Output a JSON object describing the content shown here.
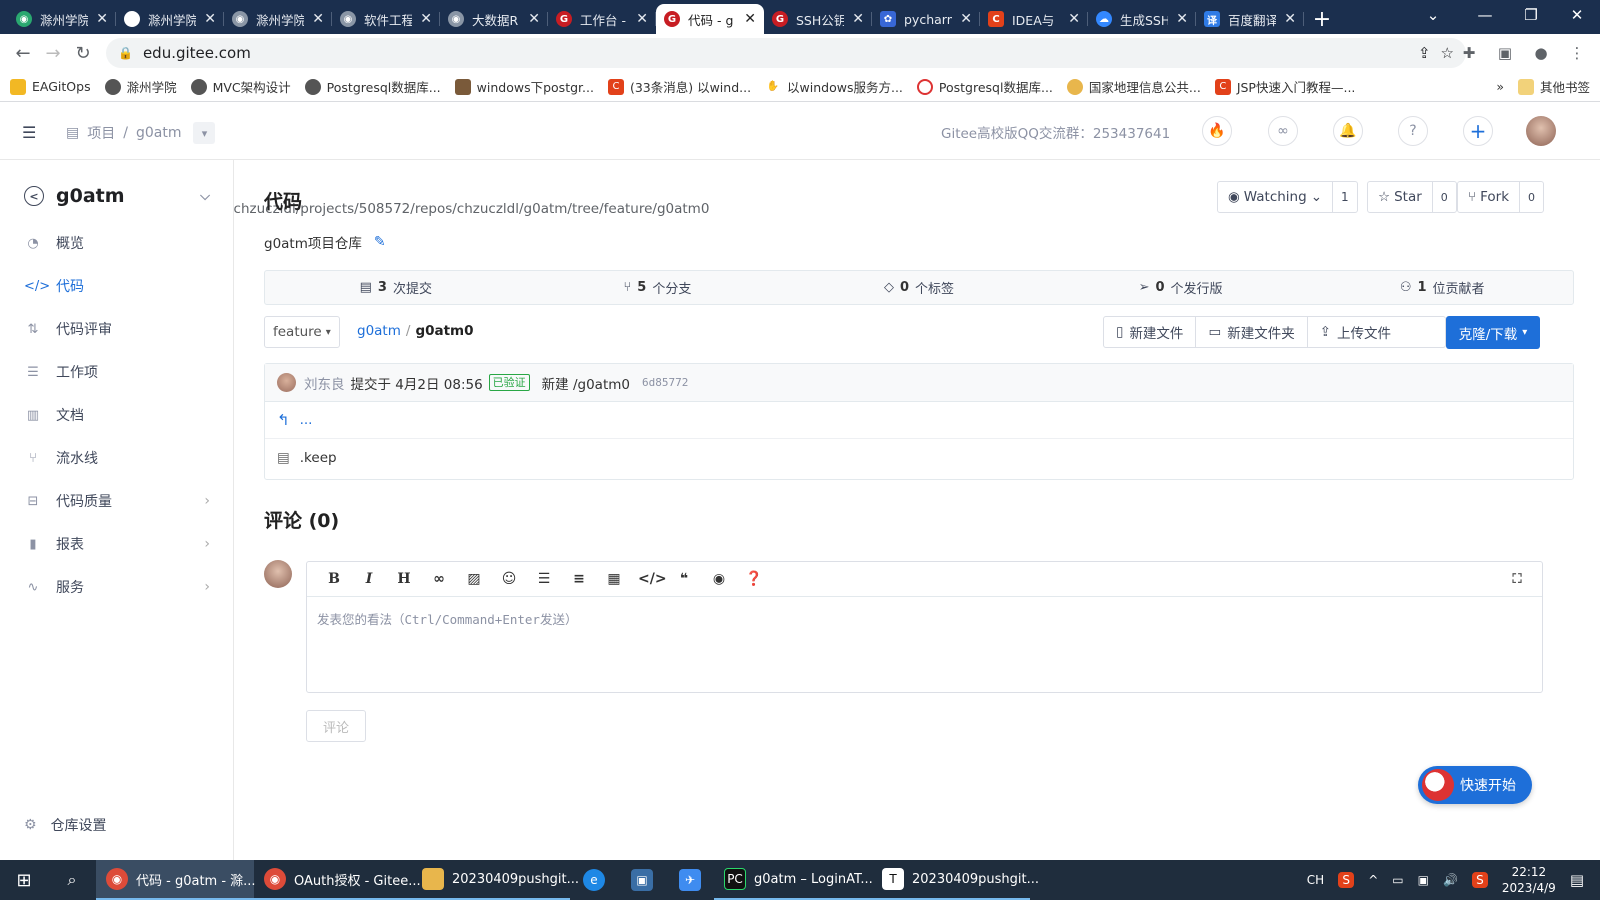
{
  "browser": {
    "tabs": [
      {
        "label": "滁州学院",
        "icon_color": "#2aa870"
      },
      {
        "label": "滁州学院",
        "icon_color": "#ffffff"
      },
      {
        "label": "滁州学院",
        "icon_color": "#8a96a6"
      },
      {
        "label": "软件工程",
        "icon_color": "#8a96a6"
      },
      {
        "label": "大数据R",
        "icon_color": "#8a96a6"
      },
      {
        "label": "工作台 -",
        "icon_color": "#c71d23"
      },
      {
        "label": "代码 - g",
        "icon_color": "#c71d23",
        "active": true
      },
      {
        "label": "SSH公钥",
        "icon_color": "#c71d23"
      },
      {
        "label": "pycharm",
        "icon_color": "#3867d6"
      },
      {
        "label": "IDEA与",
        "icon_color": "#e2411a"
      },
      {
        "label": "生成SSH",
        "icon_color": "#3388ff"
      },
      {
        "label": "百度翻译",
        "icon_color": "#2f7be6"
      }
    ],
    "url_host": "edu.gitee.com",
    "url_path": "/chzuczldl/projects/508572/repos/chzuczldl/g0atm/tree/feature/g0atm0",
    "bookmarks": [
      "EAGitOps",
      "滁州学院",
      "MVC架构设计",
      "Postgresql数据库...",
      "windows下postgr...",
      "(33条消息) 以wind...",
      "以windows服务方...",
      "Postgresql数据库...",
      "国家地理信息公共...",
      "JSP快速入门教程—..."
    ],
    "bookmarks_more": "»",
    "other_bookmarks": "其他书签"
  },
  "header": {
    "crumb_project": "项目",
    "crumb_sep": "/",
    "crumb_repo": "g0atm",
    "qq_group": "Gitee高校版QQ交流群：253437641"
  },
  "sidebar": {
    "project_name": "g0atm",
    "items": [
      {
        "label": "概览"
      },
      {
        "label": "代码"
      },
      {
        "label": "代码评审"
      },
      {
        "label": "工作项"
      },
      {
        "label": "文档"
      },
      {
        "label": "流水线"
      },
      {
        "label": "代码质量"
      },
      {
        "label": "报表"
      },
      {
        "label": "服务"
      }
    ],
    "settings": "仓库设置"
  },
  "main": {
    "title": "代码",
    "description": "g0atm项目仓库",
    "watching_label": "Watching",
    "watching_count": "1",
    "star_label": "Star",
    "star_count": "0",
    "fork_label": "Fork",
    "fork_count": "0",
    "stats": {
      "commits_n": "3",
      "commits_l": "次提交",
      "branches_n": "5",
      "branches_l": "个分支",
      "tags_n": "0",
      "tags_l": "个标签",
      "releases_n": "0",
      "releases_l": "个发行版",
      "contrib_n": "1",
      "contrib_l": "位贡献者"
    },
    "branch": "feature",
    "path_root": "g0atm",
    "path_sep": "/",
    "path_current": "g0atm0",
    "actions": {
      "new_file": "新建文件",
      "new_folder": "新建文件夹",
      "upload": "上传文件"
    },
    "clone": "克隆/下载",
    "commit": {
      "author": "刘东良",
      "time": "提交于 4月2日 08:56",
      "verified": "已验证",
      "message": "新建 /g0atm0",
      "hash": "6d85772"
    },
    "parent_dir": "...",
    "files": [
      ".keep"
    ],
    "comments_title": "评论 (0)",
    "editor_placeholder": "发表您的看法（Ctrl/Command+Enter发送）",
    "submit": "评论",
    "quick_start": "快速开始"
  },
  "taskbar": {
    "apps": [
      {
        "label": "代码 - g0atm - 滁...",
        "active": true
      },
      {
        "label": "OAuth授权 - Gitee..."
      },
      {
        "label": "20230409pushgit..."
      },
      {
        "label": ""
      },
      {
        "label": ""
      },
      {
        "label": ""
      },
      {
        "label": "g0atm – LoginAT..."
      },
      {
        "label": "20230409pushgit..."
      }
    ],
    "ime": "CH",
    "time": "22:12",
    "date": "2023/4/9"
  }
}
